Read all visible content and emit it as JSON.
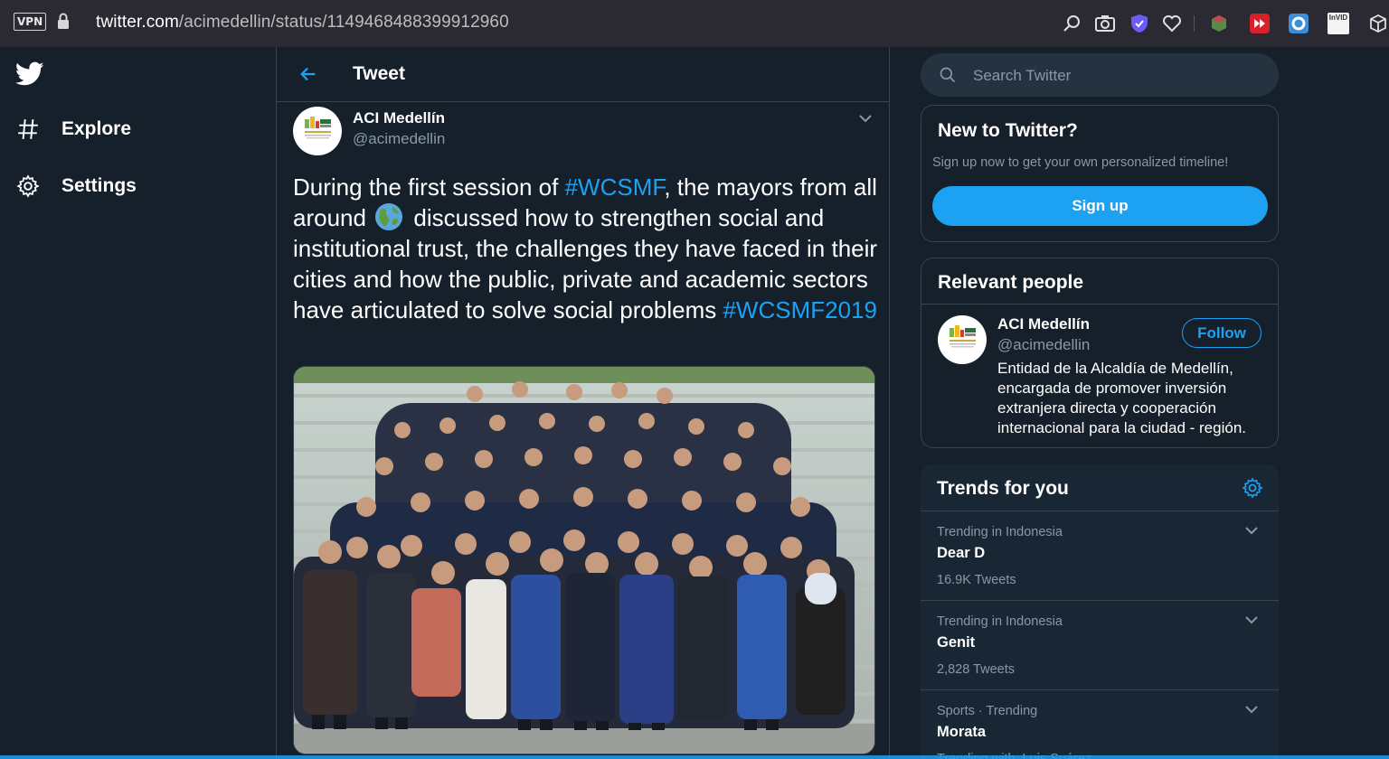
{
  "browser": {
    "vpn_label": "VPN",
    "url_domain": "twitter.com",
    "url_path": "/acimedellin/status/1149468488399912960",
    "extensions": [
      "search-icon",
      "camera-icon",
      "shield-icon",
      "heart-icon",
      "cube-icon",
      "fast-forward-icon",
      "ring-icon",
      "invid-icon",
      "box-icon"
    ],
    "extension_badge_text": "InVID"
  },
  "nav": {
    "explore_label": "Explore",
    "settings_label": "Settings"
  },
  "header": {
    "title": "Tweet"
  },
  "tweet": {
    "author_name": "ACI Medellín",
    "author_handle": "@acimedellin",
    "avatar_text": "ACI Medellín",
    "text_before": "During the first session of ",
    "hashtag1": "#WCSMF",
    "text_middle_1": ", the mayors from all around ",
    "text_middle_2": " discussed how to strengthen social and institutional trust, the challenges they have faced in their cities and how the public, private and academic sectors have articulated to solve social problems ",
    "hashtag2": "#WCSMF2019"
  },
  "search": {
    "placeholder": "Search Twitter"
  },
  "signup_card": {
    "title": "New to Twitter?",
    "subtitle": "Sign up now to get your own personalized timeline!",
    "button_label": "Sign up"
  },
  "relevant_people": {
    "title": "Relevant people",
    "person": {
      "name": "ACI Medellín",
      "handle": "@acimedellin",
      "bio": "Entidad de la Alcaldía de Medellín, encargada de promover inversión extranjera directa y cooperación internacional para la ciudad - región.",
      "follow_label": "Follow"
    }
  },
  "trends": {
    "title": "Trends for you",
    "items": [
      {
        "meta": "Trending in Indonesia",
        "name": "Dear D",
        "count": "16.9K Tweets"
      },
      {
        "meta": "Trending in Indonesia",
        "name": "Genit",
        "count": "2,828 Tweets"
      },
      {
        "meta": "Sports · Trending",
        "name": "Morata",
        "count": "Trending with: Luis Suárez"
      }
    ]
  },
  "colors": {
    "background": "#15202b",
    "accent": "#1da1f2",
    "muted_text": "#8899a6",
    "border": "#38444d"
  }
}
